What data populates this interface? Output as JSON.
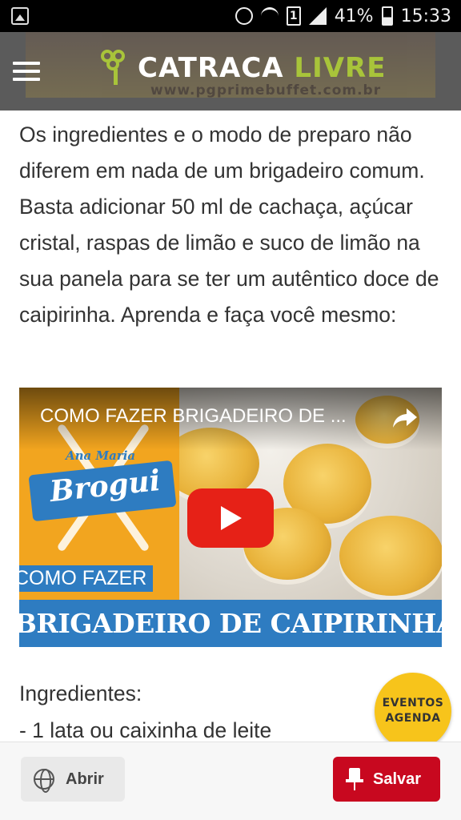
{
  "status_bar": {
    "battery_percent": "41%",
    "time": "15:33",
    "sim_slot": "1",
    "icons": [
      "gallery-icon",
      "alarm-icon",
      "wifi-icon",
      "sim-icon",
      "signal-icon",
      "battery-icon"
    ]
  },
  "header": {
    "logo_word1": "CATRACA",
    "logo_word2": "LIVRE",
    "ad_text": "www.pgprimebuffet.com.br",
    "colors": {
      "background": "#5b5b5b",
      "logo_accent": "#a8c43a"
    }
  },
  "article": {
    "paragraph": "Os ingredientes e o modo de preparo não diferem em nada de um brigadeiro comum. Basta adicionar 50 ml de cachaça, açúcar cristal, raspas de limão e suco de limão na sua panela para se ter um autêntico doce de caipirinha. Aprenda e faça você mesmo:"
  },
  "video": {
    "title": "COMO FAZER BRIGADEIRO DE ...",
    "brand_top": "Ana Maria",
    "brand_name": "Brogui",
    "overlay_small": "COMO FAZER",
    "overlay_big": "BRIGADEIRO DE CAIPIRINHA",
    "colors": {
      "blue": "#2e7cc1",
      "orange": "#f2a51f",
      "play_red": "#e62117"
    }
  },
  "ingredients": {
    "heading": "Ingredientes:",
    "first_item": "- 1 lata ou caixinha de leite"
  },
  "eventos_badge": {
    "line1": "EVENTOS",
    "line2": "AGENDA",
    "color": "#f7c41b"
  },
  "bottom_bar": {
    "open_label": "Abrir",
    "save_label": "Salvar",
    "save_color": "#c8081f"
  }
}
